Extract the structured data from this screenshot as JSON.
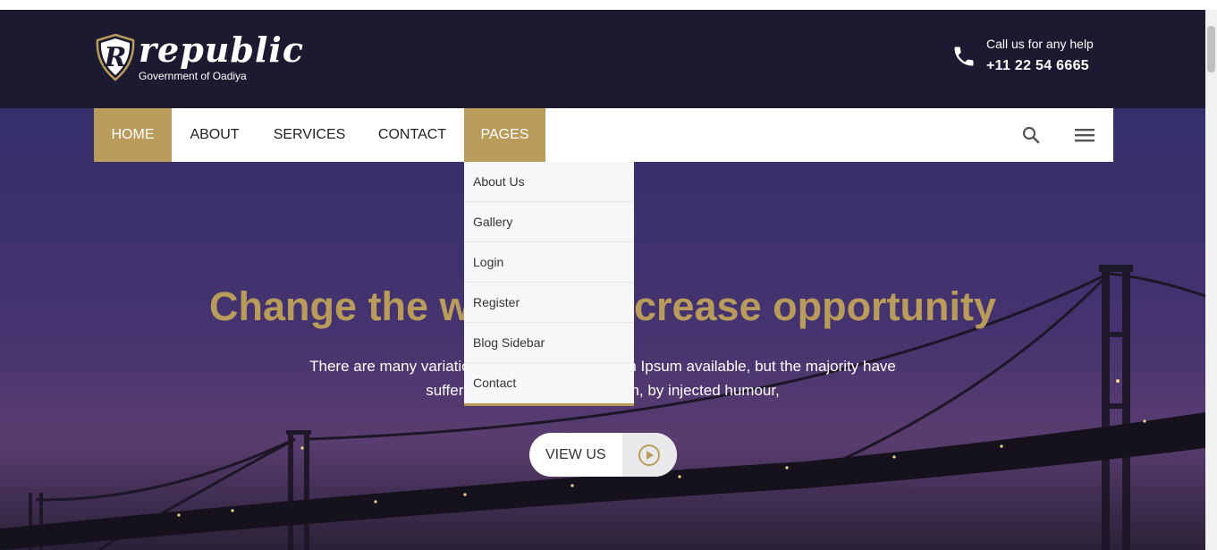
{
  "brand": {
    "logo_letter": "R",
    "name": "republic",
    "tagline": "Government of Oadiya"
  },
  "contact": {
    "label": "Call us for any help",
    "phone": "+11 22 54 6665",
    "icon": "phone-icon"
  },
  "nav": {
    "items": [
      {
        "label": "HOME",
        "active": true
      },
      {
        "label": "ABOUT",
        "active": false
      },
      {
        "label": "SERVICES",
        "active": false
      },
      {
        "label": "CONTACT",
        "active": false
      },
      {
        "label": "PAGES",
        "active": true
      }
    ],
    "search_icon": "search-icon",
    "menu_icon": "hamburger-menu-icon"
  },
  "pages_dropdown": {
    "items": [
      "About Us",
      "Gallery",
      "Login",
      "Register",
      "Blog Sidebar",
      "Contact"
    ]
  },
  "hero": {
    "title": "Change the world & increase opportunity",
    "text": "There are many variations of passages of Lorem Ipsum available, but the majority have suffered alteration in some form, by injected humour,",
    "button_label": "VIEW US",
    "button_icon": "play-icon"
  },
  "colors": {
    "header_bg": "#1b1a30",
    "accent": "#b99c5c",
    "hero_bg": "#3f3170"
  }
}
